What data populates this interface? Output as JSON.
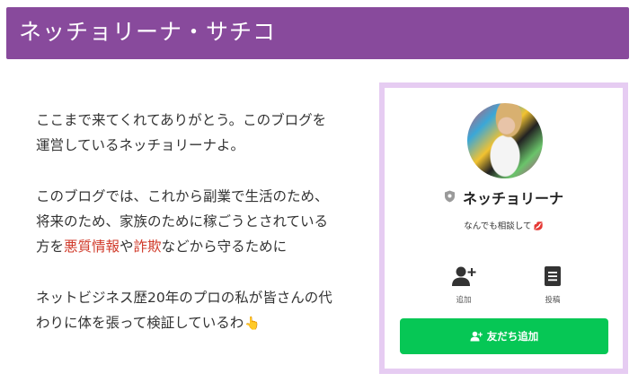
{
  "header": {
    "title": "ネッチョリーナ・サチコ"
  },
  "intro": {
    "p1": {
      "line1": "ここまで来てくれてありがとう。このブログを",
      "line2": "運営しているネッチョリーナよ。"
    },
    "p2": {
      "line1": "このブログでは、これから副業で生活のため、",
      "line2": "将来のため、家族のために稼ごうとされている",
      "line3_part1": "方を",
      "line3_hl1": "悪質情報",
      "line3_part2": "や",
      "line3_hl2": "詐欺",
      "line3_part3": "などから守るために"
    },
    "p3": {
      "line1": "ネットビジネス歴20年のプロの私が皆さんの代",
      "line2": "わりに体を張って検証しているわ",
      "hand_emoji": "👆"
    }
  },
  "line_card": {
    "name": "ネッチョリーナ",
    "status": "なんでも相談して",
    "status_emoji": "💋",
    "add_label": "追加",
    "post_label": "投稿",
    "add_friend_label": "友だち追加"
  },
  "colors": {
    "header_bg": "#884a9c",
    "card_border": "#e6ccf2",
    "line_green": "#06c755",
    "highlight": "#d03a2a"
  },
  "icons": [
    "shield-icon",
    "add-user-icon",
    "post-icon",
    "add-friend-icon"
  ]
}
